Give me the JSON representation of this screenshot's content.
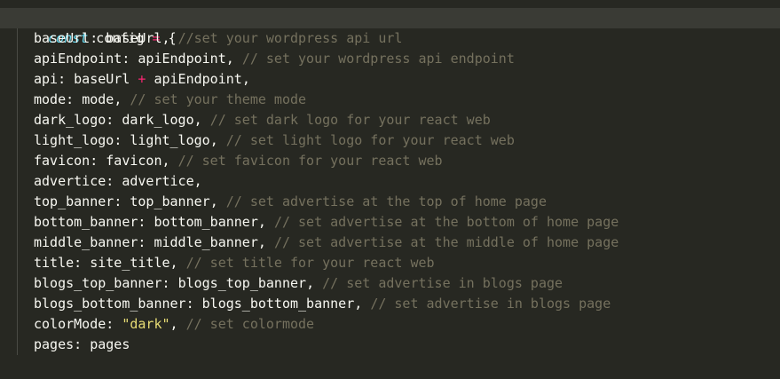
{
  "editor": {
    "colors": {
      "background": "#272822",
      "current_line": "#3a3b35",
      "keyword": "#66d9ef",
      "operator": "#f92672",
      "string": "#e6db74",
      "comment": "#75715e",
      "plain": "#f8f8f2"
    },
    "header": {
      "keyword": "const",
      "name": " config ",
      "operator": "=",
      "brace": " {"
    },
    "lines": [
      {
        "key": "baseUrl",
        "value": "baseUrl",
        "comment": "//set your wordpress api url"
      },
      {
        "key": "apiEndpoint",
        "value": "apiEndpoint",
        "comment": "// set your wordpress api endpoint"
      },
      {
        "key": "api",
        "value_left": "baseUrl",
        "operator": "+",
        "value_right": "apiEndpoint",
        "comment": ""
      },
      {
        "key": "mode",
        "value": "mode",
        "comment": "// set your theme mode"
      },
      {
        "key": "dark_logo",
        "value": "dark_logo",
        "comment": "// set dark logo for your react web"
      },
      {
        "key": "light_logo",
        "value": "light_logo",
        "comment": "// set light logo for your react web"
      },
      {
        "key": "favicon",
        "value": "favicon",
        "comment": "// set favicon for your react web"
      },
      {
        "key": "advertice",
        "value": "advertice",
        "comment": ""
      },
      {
        "key": "top_banner",
        "value": "top_banner",
        "comment": "// set advertise at the top of home page"
      },
      {
        "key": "bottom_banner",
        "value": "bottom_banner",
        "comment": "// set advertise at the bottom of home page"
      },
      {
        "key": "middle_banner",
        "value": "middle_banner",
        "comment": "// set advertise at the middle of home page"
      },
      {
        "key": "title",
        "value": "site_title",
        "comment": "// set title for your react web"
      },
      {
        "key": "blogs_top_banner",
        "value": "blogs_top_banner",
        "comment": "// set advertise in blogs page"
      },
      {
        "key": "blogs_bottom_banner",
        "value": "blogs_bottom_banner",
        "comment": "// set advertise in blogs page"
      },
      {
        "key": "colorMode",
        "value_string": "\"dark\"",
        "comment": "// set colormode"
      },
      {
        "key": "pages",
        "value": "pages",
        "comment": "",
        "last": true
      }
    ],
    "footer": "};"
  }
}
